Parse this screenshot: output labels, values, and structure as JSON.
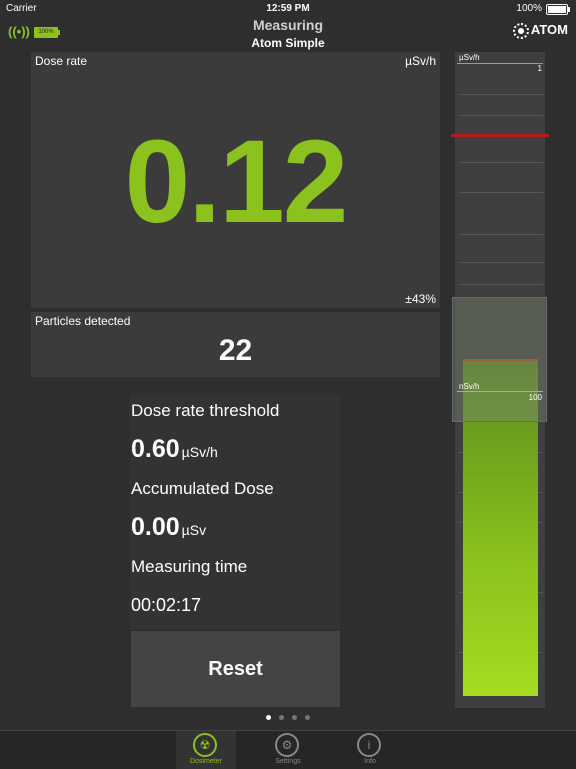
{
  "status_bar": {
    "carrier": "Carrier",
    "time": "12:59 PM",
    "battery": "100%"
  },
  "nav": {
    "title": "Measuring",
    "subtitle": "Atom Simple",
    "device_battery": "100%",
    "logo_text": "ATOM"
  },
  "dose": {
    "label": "Dose rate",
    "unit": "µSv/h",
    "value": "0.12",
    "error": "±43%",
    "color": "#8cc21d"
  },
  "particles": {
    "label": "Particles detected",
    "value": "22"
  },
  "info": {
    "threshold_label": "Dose rate threshold",
    "threshold_value": "0.60",
    "threshold_unit": "µSv/h",
    "accumulated_label": "Accumulated Dose",
    "accumulated_value": "0.00",
    "accumulated_unit": "µSv",
    "time_label": "Measuring time",
    "time_value": "00:02:17"
  },
  "reset_label": "Reset",
  "gauge": {
    "top_unit": "µSv/h",
    "top_value": "1",
    "mid_unit": "nSv/h",
    "mid_value": "100",
    "threshold_color": "#b01c1c"
  },
  "tabs": [
    {
      "label": "Dosimeter",
      "icon": "radiation-icon",
      "active": true
    },
    {
      "label": "Settings",
      "icon": "gear-icon",
      "active": false
    },
    {
      "label": "Info",
      "icon": "info-icon",
      "active": false
    }
  ],
  "pages": {
    "count": 4,
    "current": 1
  }
}
